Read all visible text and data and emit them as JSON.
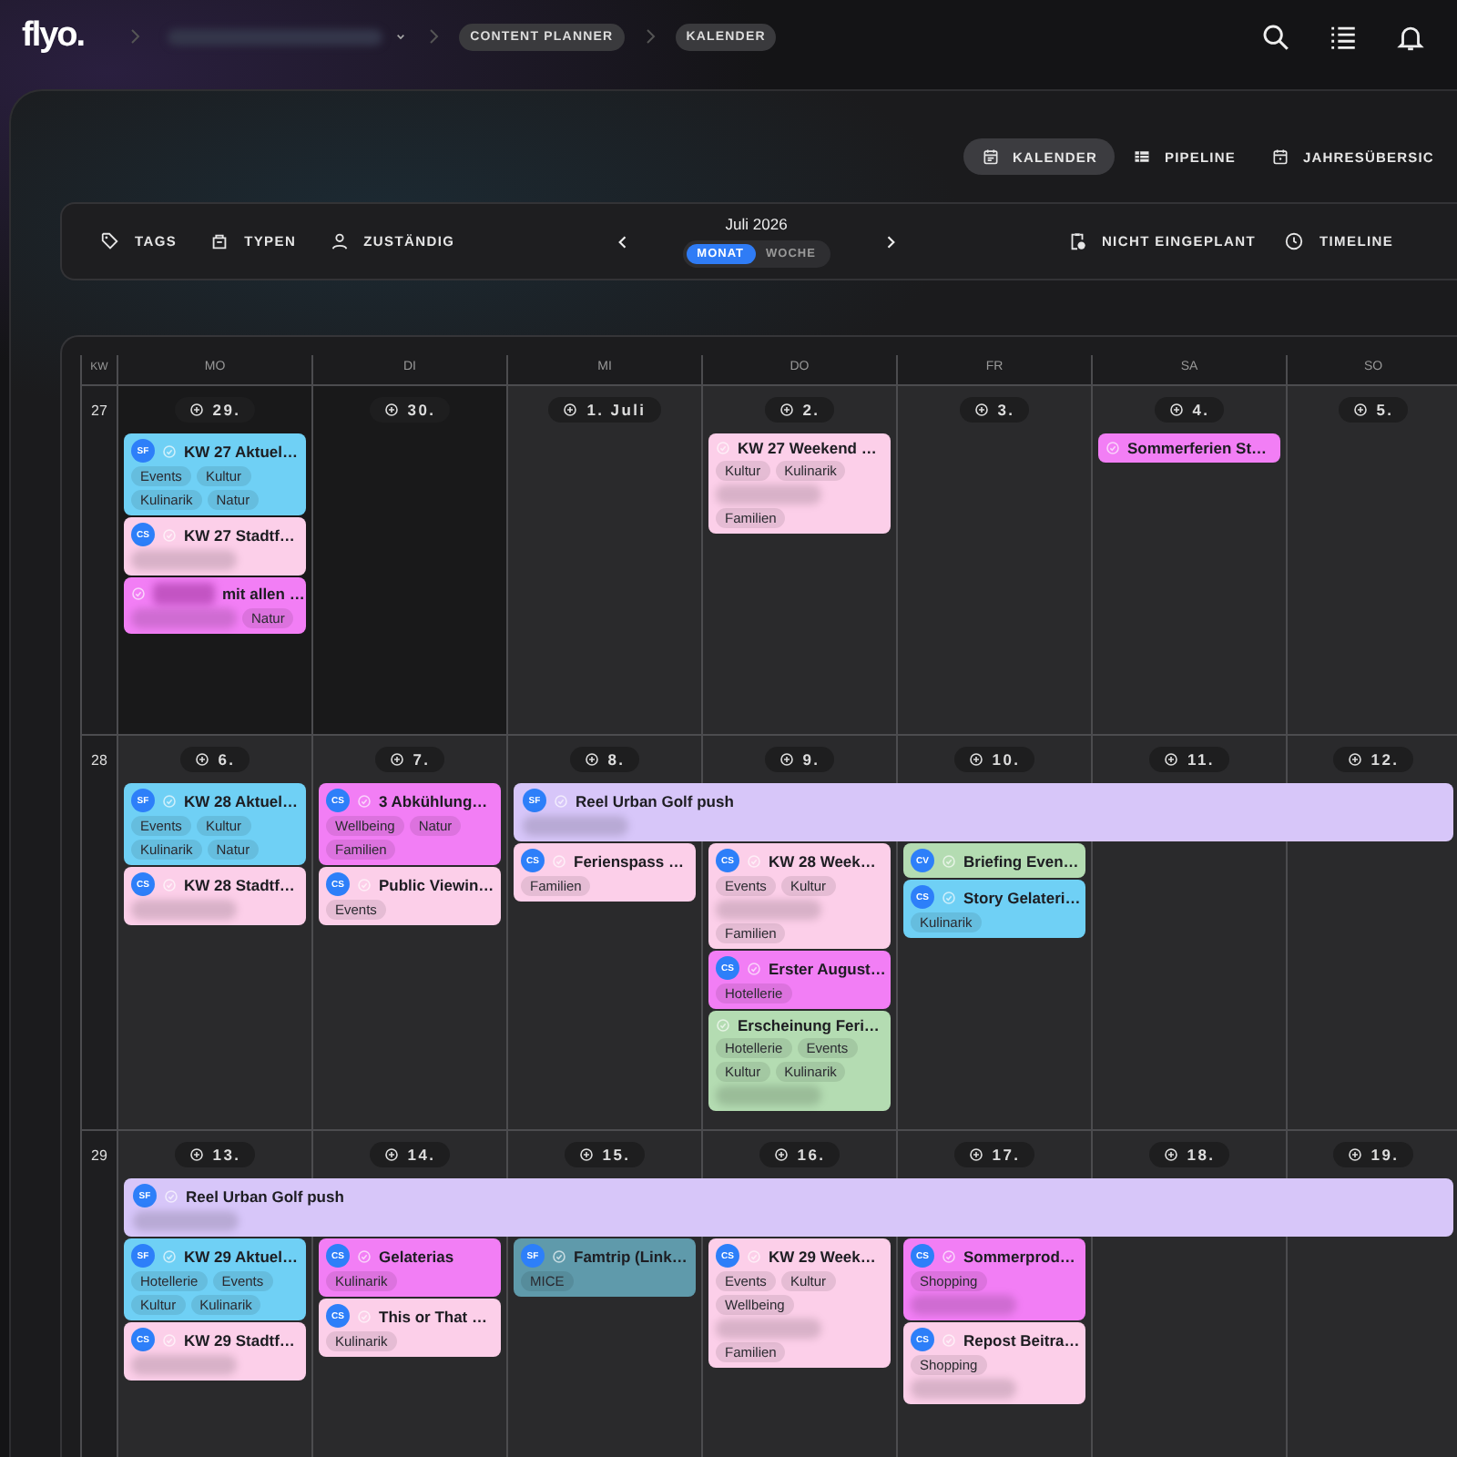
{
  "header": {
    "logo": "flyo.",
    "breadcrumbs": [
      {
        "kind": "blurred"
      },
      {
        "kind": "pill",
        "label": "CONTENT PLANNER"
      },
      {
        "kind": "pill",
        "label": "KALENDER"
      }
    ]
  },
  "view_tabs": [
    {
      "label": "KALENDER",
      "selected": true
    },
    {
      "label": "PIPELINE",
      "selected": false
    },
    {
      "label": "JAHRESÜBERSIC",
      "selected": false
    }
  ],
  "toolbar": {
    "filters": [
      {
        "label": "TAGS"
      },
      {
        "label": "TYPEN"
      },
      {
        "label": "ZUSTÄNDIG"
      }
    ],
    "month": "Juli 2026",
    "view_modes": [
      {
        "label": "MONAT",
        "selected": true
      },
      {
        "label": "WOCHE",
        "selected": false
      }
    ],
    "actions": [
      {
        "label": "NICHT EINGEPLANT"
      },
      {
        "label": "TIMELINE"
      }
    ]
  },
  "calendar": {
    "kw_label": "KW",
    "weekdays": [
      "MO",
      "DI",
      "MI",
      "DO",
      "FR",
      "SA",
      "SO"
    ],
    "weeks": [
      {
        "kw": "27",
        "days": [
          {
            "date": "29.",
            "outside": true,
            "events": [
              {
                "kind": "single",
                "color": "#6fd0f5",
                "avatar": "SF",
                "title": "KW 27 Aktuel…",
                "chips": [
                  {
                    "kind": "tag",
                    "label": "Events"
                  },
                  {
                    "kind": "tag",
                    "label": "Kultur"
                  },
                  {
                    "kind": "tag",
                    "label": "Kulinarik"
                  },
                  {
                    "kind": "tag",
                    "label": "Natur"
                  }
                ]
              },
              {
                "kind": "single",
                "color": "#fccfe9",
                "avatar": "CS",
                "title": "KW 27 Stadtf…",
                "chips": [
                  {
                    "kind": "blurred"
                  }
                ]
              },
              {
                "kind": "single",
                "color": "#f27ef5",
                "redacted_prefix": true,
                "title": "mit allen …",
                "chips": [
                  {
                    "kind": "blurred"
                  },
                  {
                    "kind": "tag",
                    "label": "Natur"
                  }
                ]
              }
            ]
          },
          {
            "date": "30.",
            "outside": true
          },
          {
            "date": "1. Juli",
            "outside": false
          },
          {
            "date": "2.",
            "outside": false,
            "events": [
              {
                "kind": "single",
                "color": "#fccfe9",
                "title": "KW 27 Weekend …",
                "chips": [
                  {
                    "kind": "tag",
                    "label": "Kultur"
                  },
                  {
                    "kind": "tag",
                    "label": "Kulinarik"
                  },
                  {
                    "kind": "blurred"
                  },
                  {
                    "kind": "tag",
                    "label": "Familien"
                  }
                ]
              }
            ]
          },
          {
            "date": "3.",
            "outside": false
          },
          {
            "date": "4.",
            "outside": false,
            "events": [
              {
                "kind": "single",
                "color": "#f27ef5",
                "title": "Sommerferien St…"
              }
            ]
          },
          {
            "date": "5.",
            "outside": false
          }
        ]
      },
      {
        "kw": "28",
        "days": [
          {
            "date": "6.",
            "outside": false,
            "events": [
              {
                "kind": "single",
                "color": "#6fd0f5",
                "avatar": "SF",
                "title": "KW 28 Aktuel…",
                "chips": [
                  {
                    "kind": "tag",
                    "label": "Events"
                  },
                  {
                    "kind": "tag",
                    "label": "Kultur"
                  },
                  {
                    "kind": "tag",
                    "label": "Kulinarik"
                  },
                  {
                    "kind": "tag",
                    "label": "Natur"
                  }
                ]
              },
              {
                "kind": "single",
                "color": "#fccfe9",
                "avatar": "CS",
                "title": "KW 28 Stadtf…",
                "chips": [
                  {
                    "kind": "blurred"
                  }
                ]
              }
            ]
          },
          {
            "date": "7.",
            "outside": false,
            "events": [
              {
                "kind": "single",
                "color": "#f27ef5",
                "avatar": "CS",
                "title": "3 Abkühlung…",
                "chips": [
                  {
                    "kind": "tag",
                    "label": "Wellbeing"
                  },
                  {
                    "kind": "tag",
                    "label": "Natur"
                  },
                  {
                    "kind": "tag",
                    "label": "Familien"
                  }
                ]
              },
              {
                "kind": "single",
                "color": "#fccfe9",
                "avatar": "CS",
                "title": "Public Viewin…",
                "chips": [
                  {
                    "kind": "tag",
                    "label": "Events"
                  }
                ]
              }
            ]
          },
          {
            "date": "8.",
            "outside": false,
            "events": [
              {
                "kind": "multi_day",
                "color": "#d7c6f9",
                "avatar": "SF",
                "title": "Reel Urban Golf push",
                "chips": [
                  {
                    "kind": "blurred"
                  }
                ]
              },
              {
                "kind": "single",
                "color": "#fccfe9",
                "avatar": "CS",
                "title": "Ferienspass …",
                "chips": [
                  {
                    "kind": "tag",
                    "label": "Familien"
                  }
                ]
              }
            ]
          },
          {
            "date": "9.",
            "outside": false,
            "events": [
              {
                "kind": "single",
                "color": "#fccfe9",
                "avatar": "CS",
                "title": "KW 28 Week…",
                "chips": [
                  {
                    "kind": "tag",
                    "label": "Events"
                  },
                  {
                    "kind": "tag",
                    "label": "Kultur"
                  },
                  {
                    "kind": "blurred"
                  },
                  {
                    "kind": "tag",
                    "label": "Familien"
                  }
                ]
              },
              {
                "kind": "single",
                "color": "#f27ef5",
                "avatar": "CS",
                "title": "Erster August…",
                "chips": [
                  {
                    "kind": "tag",
                    "label": "Hotellerie"
                  }
                ]
              },
              {
                "kind": "single",
                "color": "#b4dcb2",
                "title": "Erscheinung Feri…",
                "chips": [
                  {
                    "kind": "tag",
                    "label": "Hotellerie"
                  },
                  {
                    "kind": "tag",
                    "label": "Events"
                  },
                  {
                    "kind": "tag",
                    "label": "Kultur"
                  },
                  {
                    "kind": "tag",
                    "label": "Kulinarik"
                  },
                  {
                    "kind": "blurred"
                  }
                ]
              }
            ]
          },
          {
            "date": "10.",
            "outside": false,
            "events": [
              {
                "kind": "single",
                "color": "#b4dcb2",
                "avatar": "CV",
                "title": "Briefing Even…"
              },
              {
                "kind": "single",
                "color": "#6fd0f5",
                "avatar": "CS",
                "title": "Story Gelateri…",
                "chips": [
                  {
                    "kind": "tag",
                    "label": "Kulinarik"
                  }
                ]
              }
            ]
          },
          {
            "date": "11.",
            "outside": false
          },
          {
            "date": "12.",
            "outside": false
          }
        ]
      },
      {
        "kw": "29",
        "days": [
          {
            "date": "13.",
            "outside": false,
            "events": [
              {
                "kind": "multi_day",
                "color": "#d7c6f9",
                "avatar": "SF",
                "title": "Reel Urban Golf push",
                "chips": [
                  {
                    "kind": "blurred"
                  }
                ]
              },
              {
                "kind": "single",
                "color": "#6fd0f5",
                "avatar": "SF",
                "title": "KW 29 Aktuel…",
                "chips": [
                  {
                    "kind": "tag",
                    "label": "Hotellerie"
                  },
                  {
                    "kind": "tag",
                    "label": "Events"
                  },
                  {
                    "kind": "tag",
                    "label": "Kultur"
                  },
                  {
                    "kind": "tag",
                    "label": "Kulinarik"
                  }
                ]
              },
              {
                "kind": "single",
                "color": "#fccfe9",
                "avatar": "CS",
                "title": "KW 29 Stadtf…",
                "chips": [
                  {
                    "kind": "blurred"
                  }
                ]
              }
            ]
          },
          {
            "date": "14.",
            "outside": false,
            "events": [
              {
                "kind": "single",
                "color": "#f27ef5",
                "avatar": "CS",
                "title": "Gelaterias",
                "chips": [
                  {
                    "kind": "tag",
                    "label": "Kulinarik"
                  }
                ]
              },
              {
                "kind": "single",
                "color": "#fccfe9",
                "avatar": "CS",
                "title": "This or That …",
                "chips": [
                  {
                    "kind": "tag",
                    "label": "Kulinarik"
                  }
                ]
              }
            ]
          },
          {
            "date": "15.",
            "outside": false,
            "events": [
              {
                "kind": "single",
                "color": "#5f9aab",
                "avatar": "SF",
                "title": "Famtrip (Link…",
                "chips": [
                  {
                    "kind": "tag",
                    "label": "MICE"
                  }
                ]
              }
            ]
          },
          {
            "date": "16.",
            "outside": false,
            "events": [
              {
                "kind": "single",
                "color": "#fccfe9",
                "avatar": "CS",
                "title": "KW 29 Week…",
                "chips": [
                  {
                    "kind": "tag",
                    "label": "Events"
                  },
                  {
                    "kind": "tag",
                    "label": "Kultur"
                  },
                  {
                    "kind": "tag",
                    "label": "Wellbeing"
                  },
                  {
                    "kind": "blurred"
                  },
                  {
                    "kind": "tag",
                    "label": "Familien"
                  }
                ]
              }
            ]
          },
          {
            "date": "17.",
            "outside": false,
            "events": [
              {
                "kind": "single",
                "color": "#f27ef5",
                "avatar": "CS",
                "title": "Sommerprod…",
                "chips": [
                  {
                    "kind": "tag",
                    "label": "Shopping"
                  },
                  {
                    "kind": "blurred"
                  }
                ]
              },
              {
                "kind": "single",
                "color": "#fccfe9",
                "avatar": "CS",
                "title": "Repost Beitra…",
                "chips": [
                  {
                    "kind": "tag",
                    "label": "Shopping"
                  },
                  {
                    "kind": "blurred"
                  }
                ]
              }
            ]
          },
          {
            "date": "18.",
            "outside": false
          },
          {
            "date": "19.",
            "outside": false
          }
        ]
      }
    ]
  }
}
